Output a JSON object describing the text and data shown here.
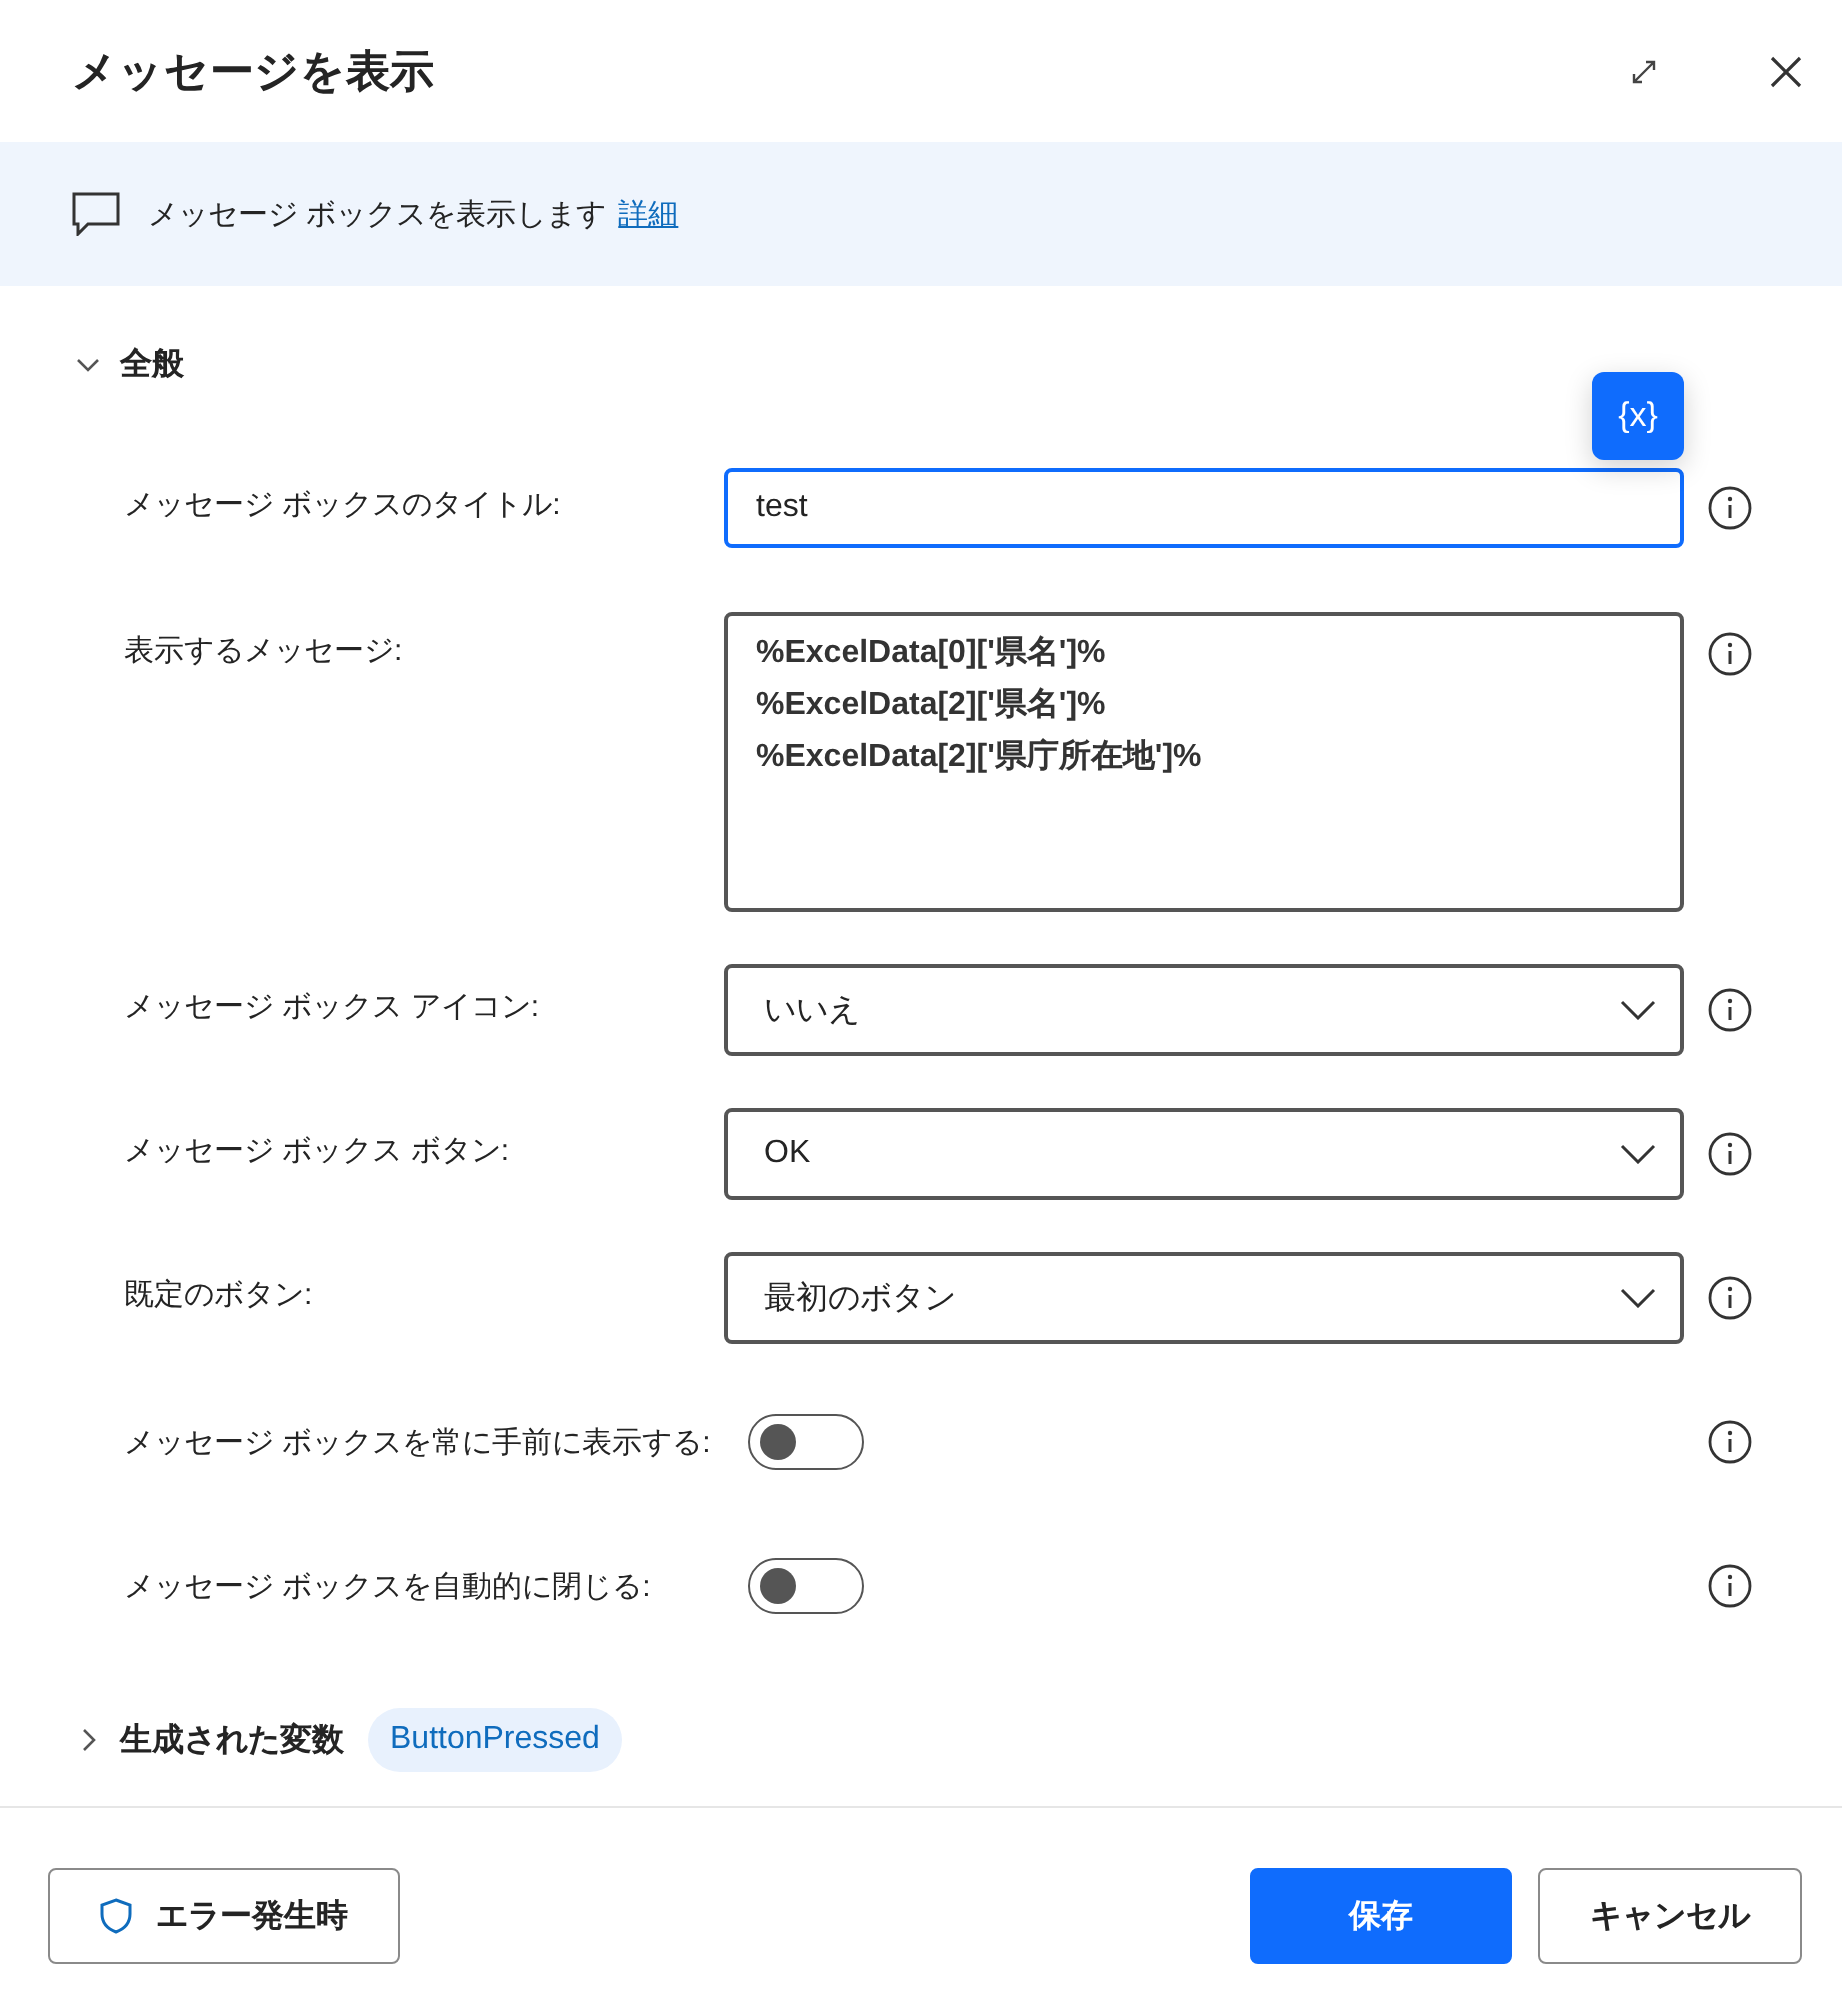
{
  "dialog": {
    "title": "メッセージを表示"
  },
  "banner": {
    "text": "メッセージ ボックスを表示します",
    "link": "詳細"
  },
  "general": {
    "title": "全般",
    "expanded": true,
    "variable_button": "{x}",
    "fields": [
      {
        "kind": "text",
        "label": "メッセージ ボックスのタイトル:",
        "value": "test",
        "focused": true
      },
      {
        "kind": "textarea",
        "label": "表示するメッセージ:",
        "value": "%ExcelData[0]['県名']%\n%ExcelData[2]['県名']%\n%ExcelData[2]['県庁所在地']%",
        "focused": false
      },
      {
        "kind": "dropdown",
        "label": "メッセージ ボックス アイコン:",
        "value": "いいえ"
      },
      {
        "kind": "dropdown",
        "label": "メッセージ ボックス ボタン:",
        "value": "OK"
      },
      {
        "kind": "dropdown",
        "label": "既定のボタン:",
        "value": "最初のボタン"
      },
      {
        "kind": "toggle",
        "label": "メッセージ ボックスを常に手前に表示する:",
        "on": false
      },
      {
        "kind": "toggle",
        "label": "メッセージ ボックスを自動的に閉じる:",
        "on": false
      }
    ]
  },
  "variables": {
    "title": "生成された変数",
    "expanded": false,
    "tags": [
      "ButtonPressed"
    ]
  },
  "footer": {
    "error_button": "エラー発生時",
    "save_button": "保存",
    "cancel_button": "キャンセル"
  }
}
